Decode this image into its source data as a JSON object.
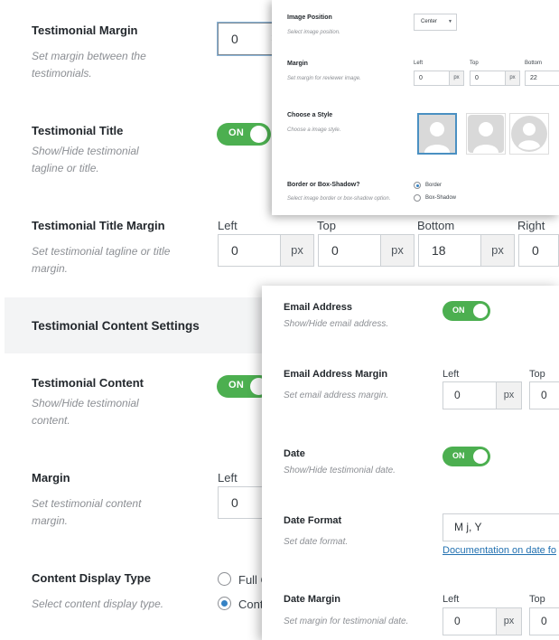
{
  "base": {
    "testimonial_margin": {
      "title": "Testimonial Margin",
      "desc": "Set margin between the testimonials.",
      "value": "0"
    },
    "testimonial_title": {
      "title": "Testimonial Title",
      "desc": "Show/Hide testimonial tagline or title.",
      "toggle": "ON"
    },
    "testimonial_title_margin": {
      "title": "Testimonial Title Margin",
      "desc": "Set testimonial tagline or title margin.",
      "labels": [
        "Left",
        "Top",
        "Bottom",
        "Right"
      ],
      "values": [
        "0",
        "0",
        "18",
        "0"
      ],
      "unit": "px"
    },
    "section_heading": "Testimonial Content Settings",
    "testimonial_content": {
      "title": "Testimonial Content",
      "desc": "Show/Hide testimonial content.",
      "toggle": "ON"
    },
    "margin": {
      "title": "Margin",
      "desc": "Set testimonial content margin.",
      "left_label": "Left",
      "left_value": "0"
    },
    "content_display_type": {
      "title": "Content Display Type",
      "desc": "Select content display type.",
      "options": [
        "Full C",
        "Cont"
      ],
      "selected_index": 1
    }
  },
  "panel1": {
    "image_position": {
      "title": "Image Position",
      "desc": "Select image position.",
      "select_value": "Center"
    },
    "margin": {
      "title": "Margin",
      "desc": "Set margin for reviewer image.",
      "labels": [
        "Left",
        "Top",
        "Bottom"
      ],
      "values": [
        "0",
        "0",
        "22"
      ],
      "unit": "px"
    },
    "choose_style": {
      "title": "Choose a Style",
      "desc": "Choose a image style."
    },
    "border_shadow": {
      "title": "Border or Box-Shadow?",
      "desc": "Select image border or box-shadow option.",
      "options": [
        "Border",
        "Box-Shadow"
      ],
      "selected_index": 0
    }
  },
  "panel2": {
    "email_address": {
      "title": "Email Address",
      "desc": "Show/Hide email address.",
      "toggle": "ON"
    },
    "email_address_margin": {
      "title": "Email Address Margin",
      "desc": "Set email address margin.",
      "labels": [
        "Left",
        "Top"
      ],
      "values": [
        "0",
        "0"
      ],
      "unit": "px"
    },
    "date": {
      "title": "Date",
      "desc": "Show/Hide testimonial date.",
      "toggle": "ON"
    },
    "date_format": {
      "title": "Date Format",
      "desc": "Set date format.",
      "value": "M j, Y",
      "link": "Documentation on date fo"
    },
    "date_margin": {
      "title": "Date Margin",
      "desc": "Set margin for testimonial date.",
      "labels": [
        "Left",
        "Top"
      ],
      "values": [
        "0",
        "0"
      ],
      "unit": "px"
    }
  },
  "colors": {
    "toggle_on": "#4caf50",
    "link": "#2271b1",
    "radio_checked": "#3582c4"
  }
}
